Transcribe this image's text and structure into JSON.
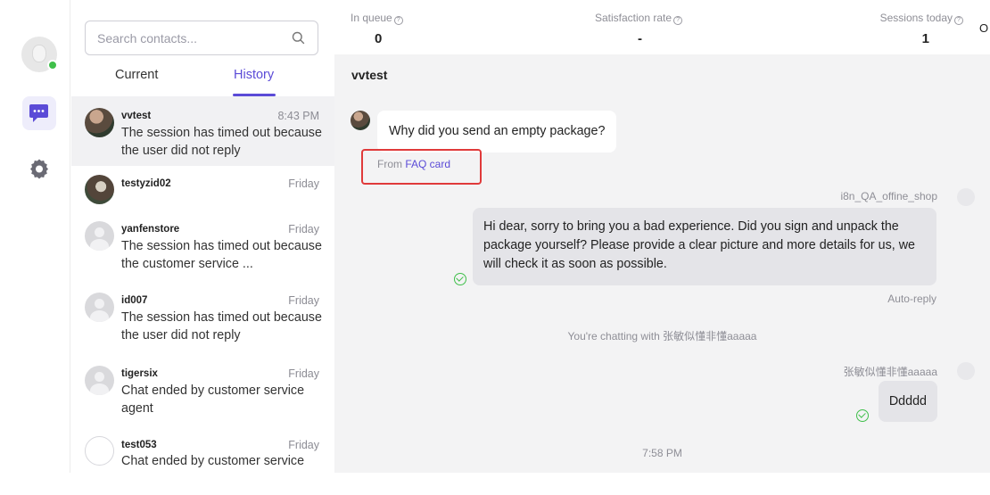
{
  "search": {
    "placeholder": "Search contacts..."
  },
  "tabs": [
    {
      "label": "Current"
    },
    {
      "label": "History",
      "active": true
    }
  ],
  "contacts": [
    {
      "name": "vvtest",
      "time": "8:43 PM",
      "preview": "The session has timed out because the user did not reply",
      "avatar": "photo",
      "active": true
    },
    {
      "name": "testyzid02",
      "time": "Friday",
      "preview": "",
      "avatar": "photo2"
    },
    {
      "name": "yanfenstore",
      "time": "Friday",
      "preview": "The session has timed out because the customer service ...",
      "avatar": "blank"
    },
    {
      "name": "id007",
      "time": "Friday",
      "preview": "The session has timed out because the user did not reply",
      "avatar": "blank"
    },
    {
      "name": "tigersix",
      "time": "Friday",
      "preview": "Chat ended by customer service agent",
      "avatar": "blank"
    },
    {
      "name": "test053",
      "time": "Friday",
      "preview": "Chat ended by customer service",
      "avatar": "sketch"
    }
  ],
  "stats": {
    "in_queue": {
      "label": "In queue",
      "value": "0"
    },
    "satisfaction": {
      "label": "Satisfaction rate",
      "value": "-"
    },
    "sessions": {
      "label": "Sessions today",
      "value": "1"
    },
    "overflow": "O"
  },
  "chat": {
    "title": "vvtest",
    "incoming": {
      "text": "Why did you send an empty package?"
    },
    "source": {
      "prefix": "From",
      "link": "FAQ card"
    },
    "agent_name": "i8n_QA_offine_shop",
    "reply": "Hi dear, sorry to bring you a bad experience. Did you sign and unpack the package yourself?  Please provide a clear picture and more details for us, we will check it as soon as possible.",
    "reply_note": "Auto-reply",
    "system_note": "You're chatting with 张敏似懂非懂aaaaa",
    "agent2_name": "张敏似懂非懂aaaaa",
    "reply2": "Ddddd",
    "timestamp": "7:58 PM"
  },
  "colors": {
    "accent": "#5b4bd7",
    "online": "#3fbf4a",
    "highlight_box": "#e03a3a"
  },
  "icons": [
    "search-icon",
    "chat-icon",
    "settings-icon",
    "help-icon",
    "check-icon"
  ]
}
